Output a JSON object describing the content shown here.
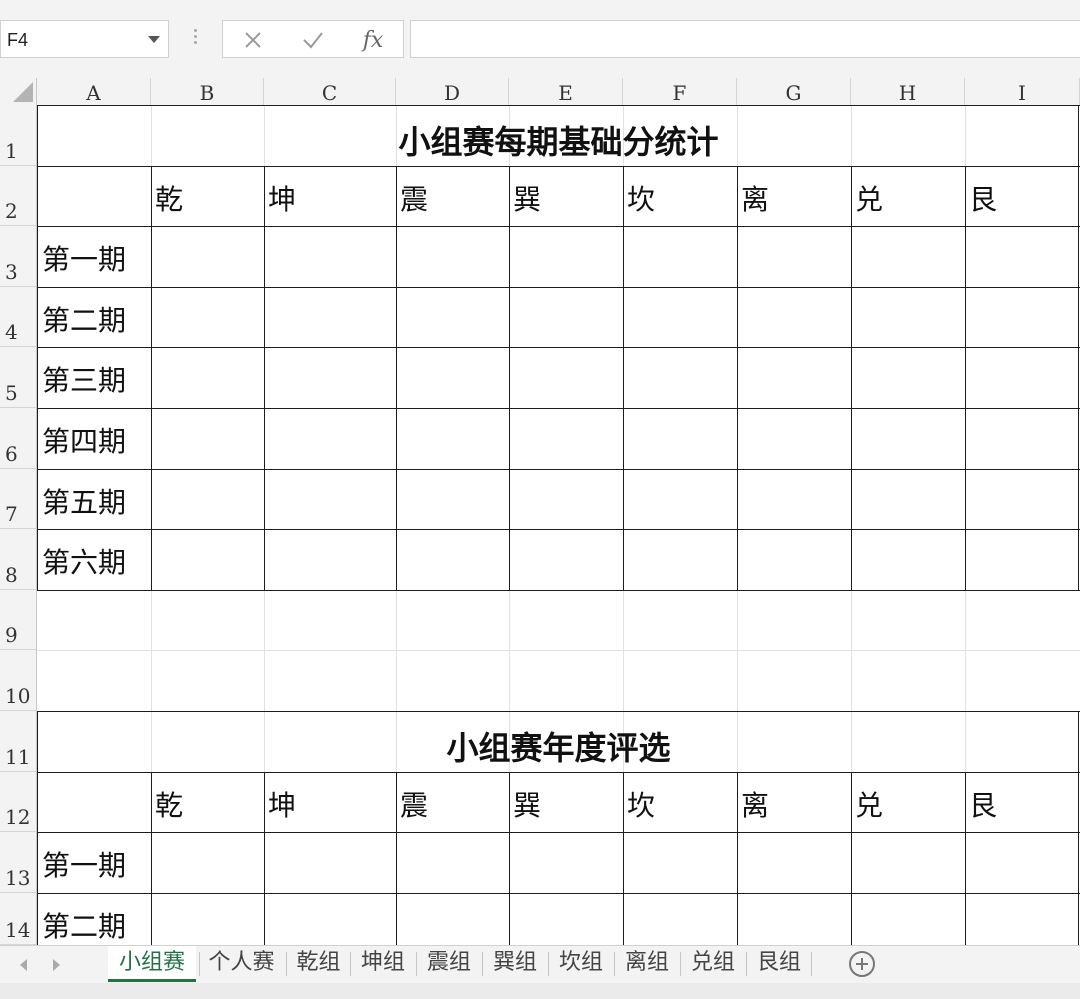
{
  "name_box": {
    "value": "F4"
  },
  "formula_bar": {
    "value": ""
  },
  "columns": [
    "A",
    "B",
    "C",
    "D",
    "E",
    "F",
    "G",
    "H",
    "I"
  ],
  "rows": [
    "1",
    "2",
    "3",
    "4",
    "5",
    "6",
    "7",
    "8",
    "9",
    "10",
    "11",
    "12",
    "13",
    "14"
  ],
  "table1": {
    "title": "小组赛每期基础分统计",
    "headers": [
      "乾",
      "坤",
      "震",
      "巽",
      "坎",
      "离",
      "兑",
      "艮"
    ],
    "periods": [
      "第一期",
      "第二期",
      "第三期",
      "第四期",
      "第五期",
      "第六期"
    ]
  },
  "table2": {
    "title": "小组赛年度评选",
    "headers": [
      "乾",
      "坤",
      "震",
      "巽",
      "坎",
      "离",
      "兑",
      "艮"
    ],
    "periods": [
      "第一期",
      "第二期"
    ]
  },
  "sheet_tabs": [
    "小组赛",
    "个人赛",
    "乾组",
    "坤组",
    "震组",
    "巽组",
    "坎组",
    "离组",
    "兑组",
    "艮组"
  ],
  "active_tab": "小组赛",
  "colors": {
    "accent": "#207245",
    "border": "#1e1e1e",
    "gridline": "#e1e1e1"
  },
  "icons": {
    "cancel": "close-icon",
    "enter": "check-icon",
    "function": "fx-icon",
    "add_sheet": "plus-circle-icon"
  }
}
